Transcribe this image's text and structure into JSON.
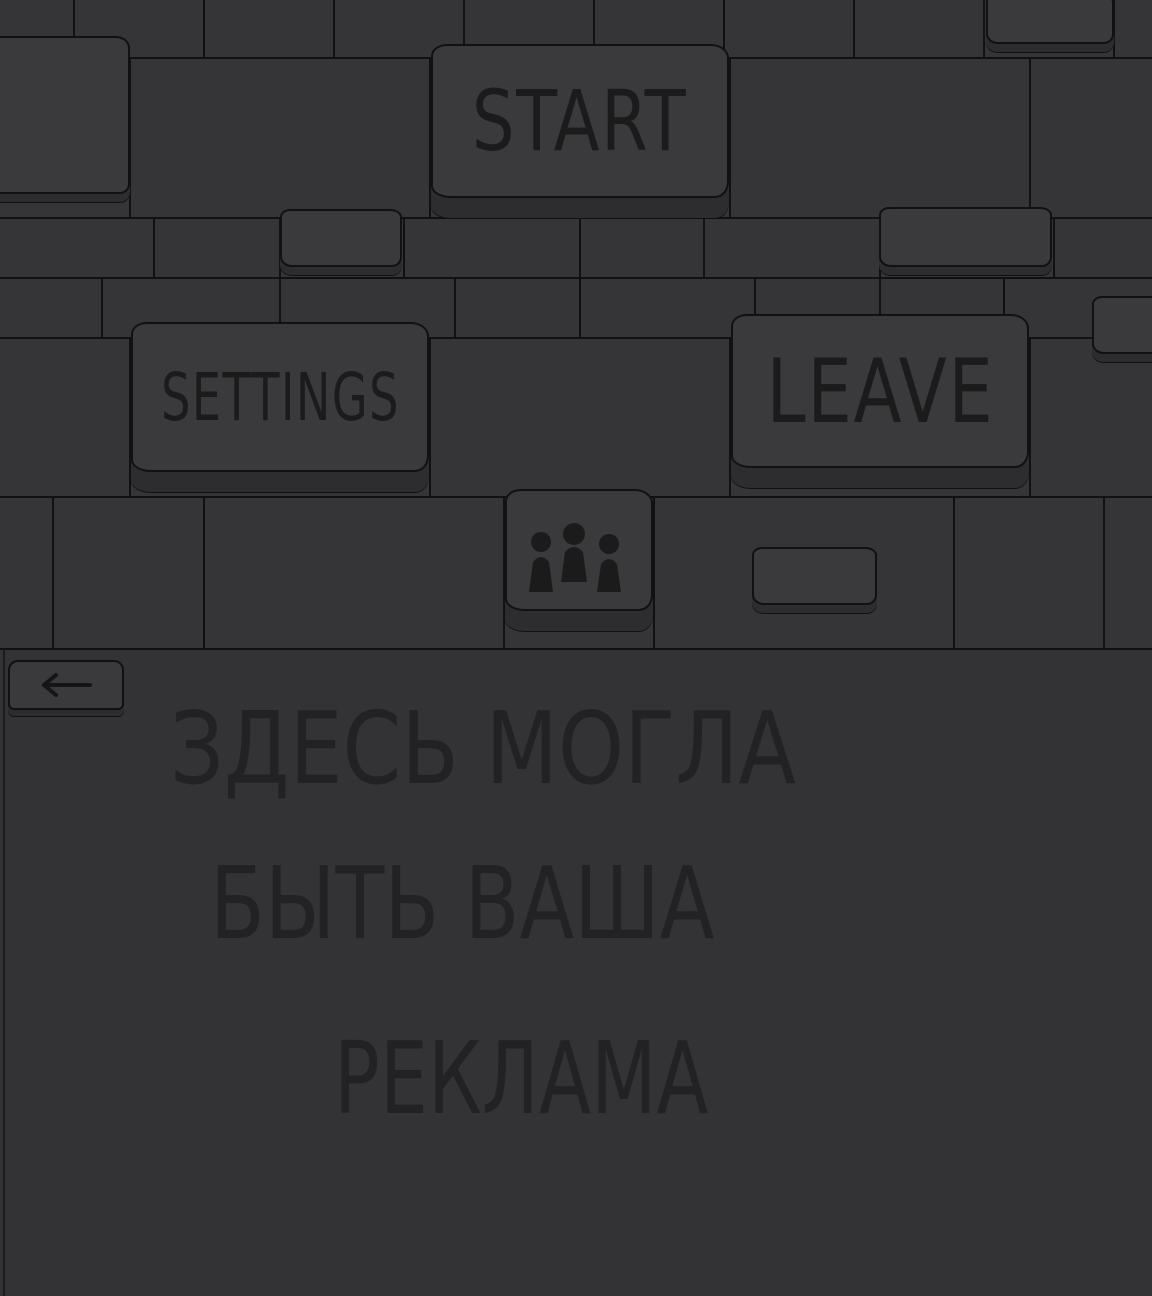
{
  "menu": {
    "start_label": "START",
    "settings_label": "SETTINGS",
    "leave_label": "LEAVE",
    "players_icon": "people-group-icon",
    "back_icon": "arrow-left-icon"
  },
  "ad": {
    "line1": "ЗДЕСЬ МОГЛА",
    "line2": "БЫТЬ ВАША",
    "line3": "РЕКЛАМА"
  },
  "colors": {
    "background": "#343436",
    "button_face": "#3a3a3c",
    "outline": "#111111",
    "text": "#1b1b1c"
  }
}
